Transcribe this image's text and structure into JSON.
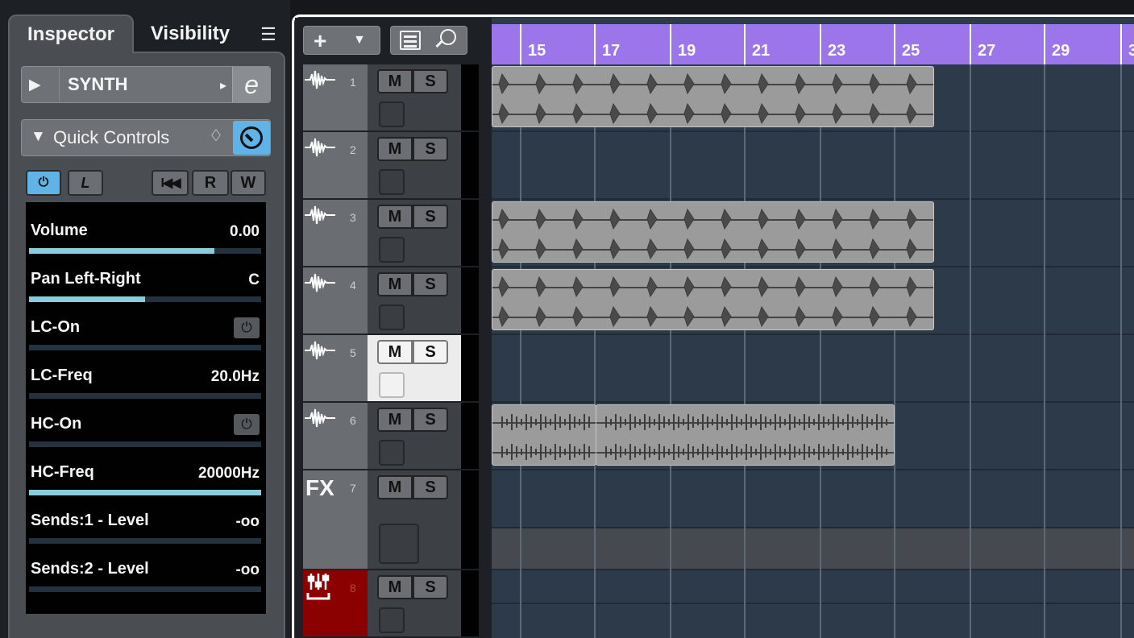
{
  "inspector": {
    "tab_inspector": "Inspector",
    "tab_visibility": "Visibility",
    "tab_menu_icon": "menu-icon",
    "track_name": "SYNTH",
    "edit_icon": "e",
    "quick_controls_label": "Quick Controls",
    "quick_controls_expanded": true,
    "buttons": {
      "read": "R",
      "write": "W",
      "learn": "L"
    },
    "params": [
      {
        "name": "Volume",
        "value": "0.00",
        "level": 0.8,
        "type": "slider"
      },
      {
        "name": "Pan Left-Right",
        "value": "C",
        "level": 0.5,
        "type": "slider"
      },
      {
        "name": "LC-On",
        "value": "",
        "level": 0,
        "type": "toggle"
      },
      {
        "name": "LC-Freq",
        "value": "20.0Hz",
        "level": 0,
        "type": "slider"
      },
      {
        "name": "HC-On",
        "value": "",
        "level": 0,
        "type": "toggle"
      },
      {
        "name": "HC-Freq",
        "value": "20000Hz",
        "level": 1,
        "type": "slider"
      },
      {
        "name": "Sends:1 - Level",
        "value": "-oo",
        "level": 0,
        "type": "slider"
      },
      {
        "name": "Sends:2 - Level",
        "value": "-oo",
        "level": 0,
        "type": "slider"
      }
    ]
  },
  "toolbar": {
    "add_label": "+",
    "list_icon": "list-icon",
    "search_icon": "search-icon"
  },
  "tracks": [
    {
      "num": "1",
      "kind": "audio",
      "m": "M",
      "s": "S",
      "selected": false
    },
    {
      "num": "2",
      "kind": "audio",
      "m": "M",
      "s": "S",
      "selected": false
    },
    {
      "num": "3",
      "kind": "audio",
      "m": "M",
      "s": "S",
      "selected": false
    },
    {
      "num": "4",
      "kind": "audio",
      "m": "M",
      "s": "S",
      "selected": false
    },
    {
      "num": "5",
      "kind": "audio",
      "m": "M",
      "s": "S",
      "selected": true
    },
    {
      "num": "6",
      "kind": "audio",
      "m": "M",
      "s": "S",
      "selected": false
    },
    {
      "num": "7",
      "kind": "fx",
      "label": "FX",
      "m": "M",
      "s": "S",
      "selected": false
    },
    {
      "num": "8",
      "kind": "instrument",
      "m": "M",
      "s": "S",
      "selected": false
    }
  ],
  "ruler": {
    "bars": [
      "15",
      "17",
      "19",
      "21",
      "23",
      "25",
      "27",
      "29",
      "3"
    ]
  },
  "colors": {
    "ruler": "#9d75ea",
    "accent": "#5fb3e6",
    "slider_fill": "#8ccbdc",
    "instrument_track": "#8b0000"
  }
}
